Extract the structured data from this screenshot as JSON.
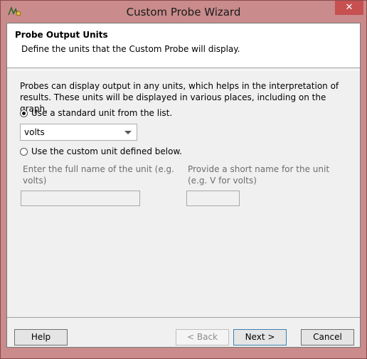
{
  "window": {
    "title": "Custom Probe Wizard",
    "close_glyph": "✕",
    "icon": "probe-app-icon"
  },
  "header": {
    "title": "Probe Output Units",
    "subtitle": "Define the units that the Custom Probe will display."
  },
  "description": "Probes can display output in any units, which helps in the interpretation of results. These units will be displayed in various places, including on the graph.",
  "options": {
    "standard_label": "Use a standard unit from the list.",
    "standard_checked": true,
    "unit_selected": "volts",
    "custom_label": "Use the custom unit defined below.",
    "custom_checked": false,
    "full_name_label": "Enter the full name of the unit (e.g. volts)",
    "full_name_value": "",
    "short_name_label": "Provide a short name for the unit (e.g. V for volts)",
    "short_name_value": ""
  },
  "buttons": {
    "help": "Help",
    "back": "< Back",
    "next": "Next >",
    "cancel": "Cancel"
  },
  "colors": {
    "titlebar": "#c98b8b",
    "close": "#c75050",
    "dialog": "#f0f0f0"
  }
}
